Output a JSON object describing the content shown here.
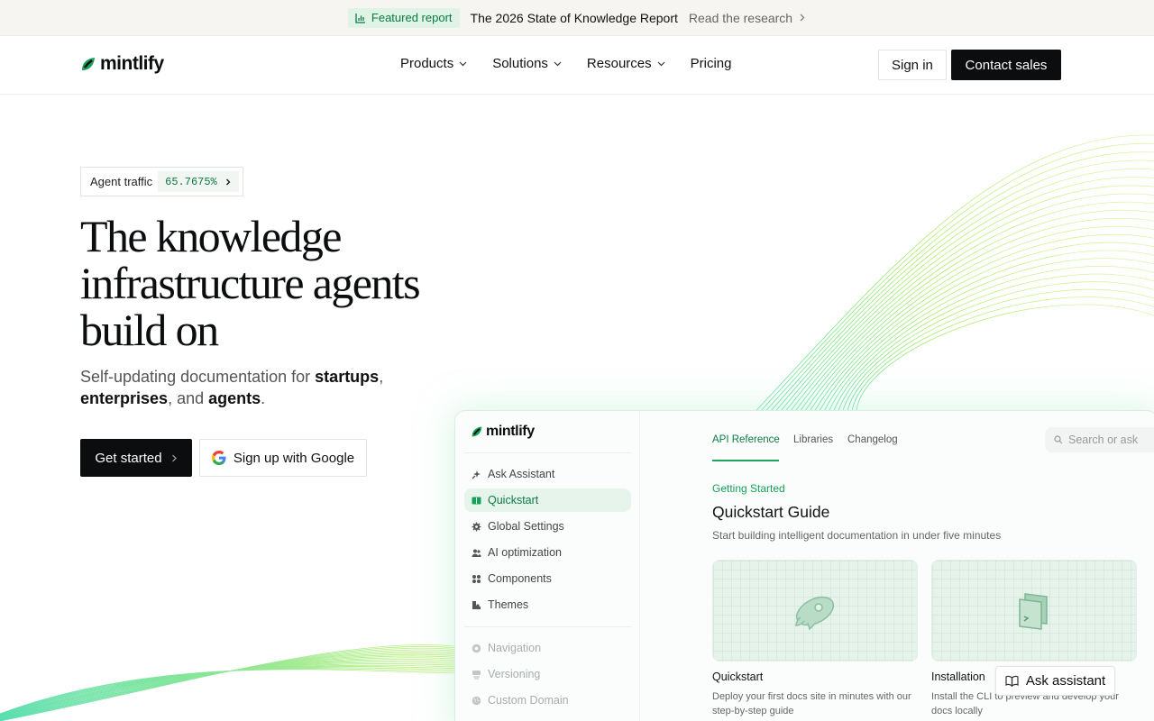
{
  "announcement": {
    "badge_label": "Featured report",
    "title": "The 2026 State of Knowledge Report",
    "link_label": "Read the research"
  },
  "nav": {
    "logo_text": "mintlify",
    "menu": [
      {
        "label": "Products"
      },
      {
        "label": "Solutions"
      },
      {
        "label": "Resources"
      },
      {
        "label": "Pricing"
      }
    ],
    "signin_label": "Sign in",
    "contact_label": "Contact sales"
  },
  "hero": {
    "traffic_label": "Agent traffic",
    "traffic_value": "65.7675%",
    "headline": "The knowledge infrastructure agents build on",
    "sub_prefix": "Self-updating documentation for ",
    "sub_startups": "startups",
    "sub_comma": ", ",
    "sub_enterprises": "enterprises",
    "sub_and": ", and ",
    "sub_agents": "agents",
    "sub_period": ".",
    "get_started_label": "Get started",
    "google_label": "Sign up with Google"
  },
  "preview": {
    "logo_text": "mintlify",
    "sidebar_items": [
      {
        "label": "Ask Assistant",
        "icon": "sparkle-icon"
      },
      {
        "label": "Quickstart",
        "icon": "book-icon"
      },
      {
        "label": "Global Settings",
        "icon": "gear-icon"
      },
      {
        "label": "AI optimization",
        "icon": "users-icon"
      },
      {
        "label": "Components",
        "icon": "grid-icon"
      },
      {
        "label": "Themes",
        "icon": "palette-icon"
      }
    ],
    "sidebar_items_dim": [
      {
        "label": "Navigation",
        "icon": "compass-icon"
      },
      {
        "label": "Versioning",
        "icon": "layers-icon"
      },
      {
        "label": "Custom Domain",
        "icon": "globe-icon"
      }
    ],
    "tabs": [
      "API Reference",
      "Libraries",
      "Changelog"
    ],
    "search_placeholder": "Search or ask",
    "eyebrow": "Getting Started",
    "title": "Quickstart Guide",
    "description": "Start building intelligent documentation in under five minutes",
    "cards": [
      {
        "title": "Quickstart",
        "description": "Deploy your first docs site in minutes with our step-by-step guide",
        "icon": "rocket-icon"
      },
      {
        "title": "Installation",
        "description": "Install the CLI to preview and develop your docs locally",
        "icon": "terminal-icon"
      }
    ]
  },
  "ask_assistant_label": "Ask assistant",
  "colors": {
    "brand_green": "#16a058",
    "dark": "#0b0d0e"
  }
}
